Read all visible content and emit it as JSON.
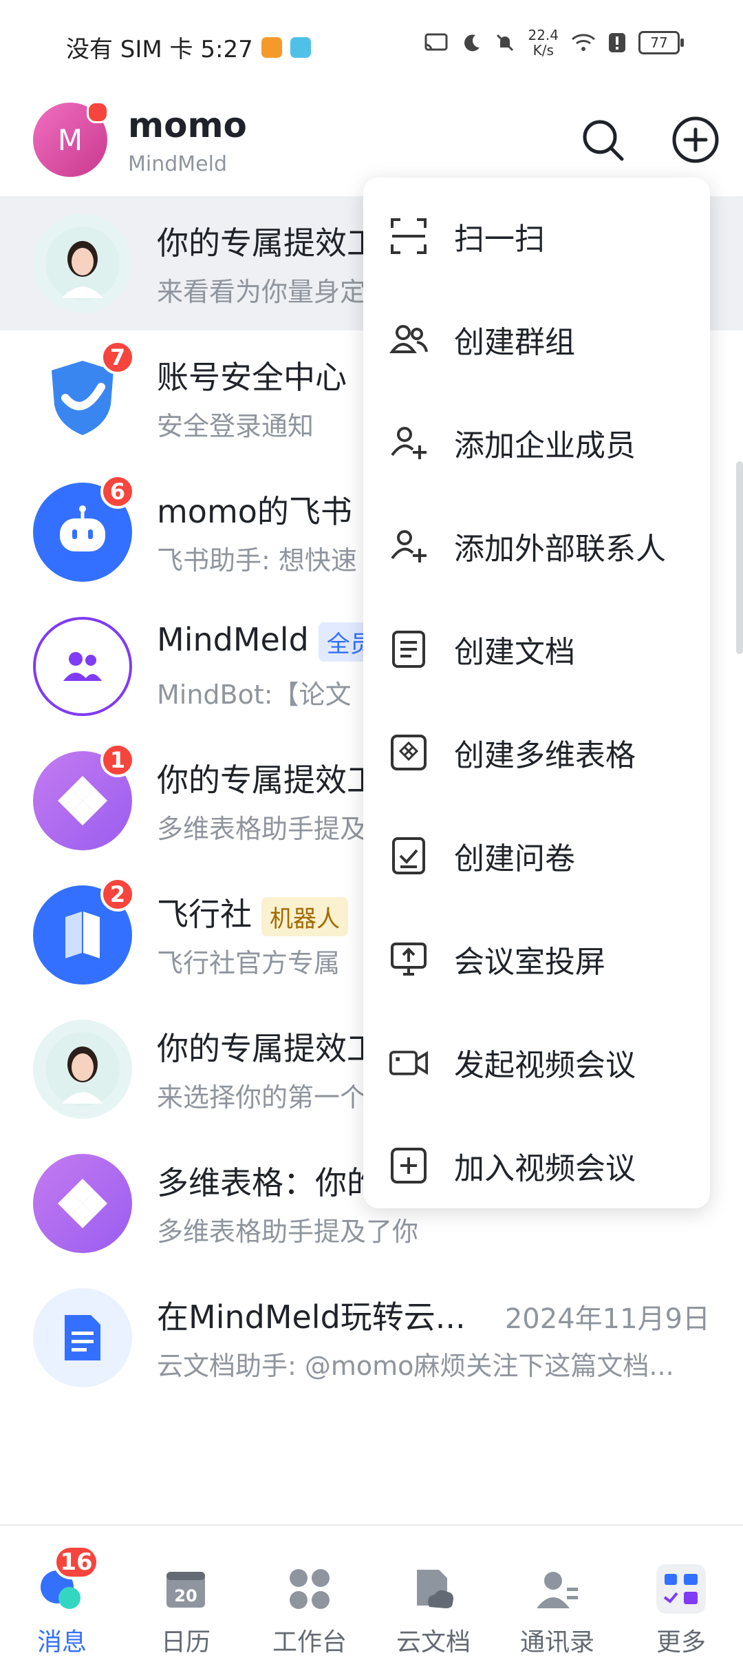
{
  "status_bar": {
    "left_text": "没有 SIM 卡 5:27",
    "speed_top": "22.4",
    "speed_bottom": "K/s",
    "battery": "77"
  },
  "header": {
    "avatar_letter": "M",
    "user_name": "momo",
    "org_name": "MindMeld"
  },
  "chats": [
    {
      "title": "你的专属提效工",
      "subtitle": "来看看为你量身定",
      "badge": "",
      "avatar": "person-photo"
    },
    {
      "title": "账号安全中心",
      "subtitle": "安全登录通知",
      "badge": "7",
      "avatar": "shield"
    },
    {
      "title": "momo的飞书",
      "subtitle": "飞书助手: 想快速",
      "badge": "6",
      "avatar": "robot"
    },
    {
      "title": "MindMeld",
      "tag": "全员",
      "subtitle": "MindBot:【论文",
      "badge": "",
      "avatar": "group"
    },
    {
      "title": "你的专属提效工",
      "subtitle": "多维表格助手提及",
      "badge": "1",
      "avatar": "base"
    },
    {
      "title": "飞行社",
      "tag": "机器人",
      "subtitle": "飞行社官方专属",
      "badge": "2",
      "avatar": "book"
    },
    {
      "title": "你的专属提效工",
      "subtitle": "来选择你的第一个",
      "badge": "",
      "avatar": "person-photo"
    },
    {
      "title": "多维表格：你的",
      "subtitle": "多维表格助手提及了你",
      "badge": "",
      "avatar": "base"
    },
    {
      "title": "在MindMeld玩转云...",
      "subtitle": "云文档助手: @momo麻烦关注下这篇文档...",
      "time": "2024年11月9日",
      "badge": "",
      "avatar": "doc"
    }
  ],
  "menu": {
    "items": [
      {
        "label": "扫一扫",
        "icon": "scan-icon"
      },
      {
        "label": "创建群组",
        "icon": "group-icon"
      },
      {
        "label": "添加企业成员",
        "icon": "add-member-icon"
      },
      {
        "label": "添加外部联系人",
        "icon": "add-contact-icon"
      },
      {
        "label": "创建文档",
        "icon": "document-icon"
      },
      {
        "label": "创建多维表格",
        "icon": "base-table-icon"
      },
      {
        "label": "创建问卷",
        "icon": "survey-icon"
      },
      {
        "label": "会议室投屏",
        "icon": "screen-share-icon"
      },
      {
        "label": "发起视频会议",
        "icon": "video-icon"
      },
      {
        "label": "加入视频会议",
        "icon": "join-meeting-icon"
      }
    ]
  },
  "tabbar": {
    "tabs": [
      {
        "label": "消息",
        "badge": "16",
        "active": true
      },
      {
        "label": "日历",
        "calendar_day": "20"
      },
      {
        "label": "工作台"
      },
      {
        "label": "云文档"
      },
      {
        "label": "通讯录"
      },
      {
        "label": "更多"
      }
    ]
  },
  "colors": {
    "accent": "#3370ff",
    "badge": "#f5453d",
    "tag_blue_bg": "#e1eaff",
    "tag_yellow_bg": "#faf1d1"
  }
}
